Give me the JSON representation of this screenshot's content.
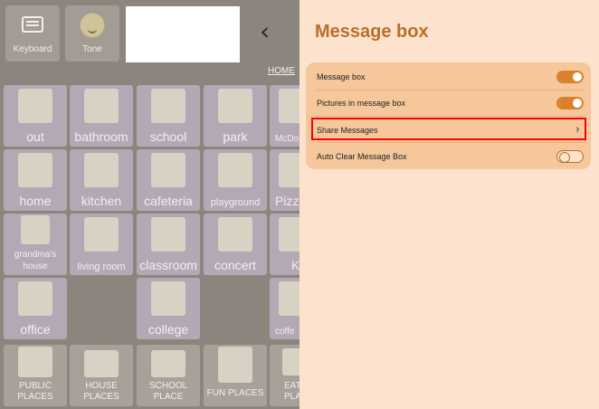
{
  "toolbar": {
    "keyboard_label": "Keyboard",
    "tone_label": "Tone"
  },
  "breadcrumb": {
    "home": "HOME"
  },
  "grid": {
    "cells": [
      {
        "label": "out",
        "icon": "door-out-icon"
      },
      {
        "label": "bathroom",
        "icon": "bathtub-icon"
      },
      {
        "label": "school",
        "icon": "students-icon"
      },
      {
        "label": "park",
        "icon": "park-bench-icon"
      },
      {
        "label": "McDo",
        "icon": "mcdonalds-icon"
      },
      {
        "label": "home",
        "icon": "house-icon"
      },
      {
        "label": "kitchen",
        "icon": "kitchen-icon"
      },
      {
        "label": "cafeteria",
        "icon": "cafeteria-icon"
      },
      {
        "label": "playground",
        "icon": "swing-set-icon"
      },
      {
        "label": "Pizz",
        "icon": "pizza-icon"
      },
      {
        "label": "grandma's house",
        "icon": "grandma-icon"
      },
      {
        "label": "living room",
        "icon": "sofa-icon"
      },
      {
        "label": "classroom",
        "icon": "teacher-icon"
      },
      {
        "label": "concert",
        "icon": "performer-icon"
      },
      {
        "label": "K",
        "icon": "kfc-icon"
      },
      {
        "label": "office",
        "icon": "desk-icon"
      },
      {
        "label": "college",
        "icon": "college-building-icon"
      },
      {
        "label": "coffe",
        "icon": "coffee-icon"
      }
    ],
    "categories": [
      {
        "label": "PUBLIC PLACES",
        "icon": "people-icon"
      },
      {
        "label": "HOUSE PLACES",
        "icon": "house-outline-icon"
      },
      {
        "label": "SCHOOL PLACE",
        "icon": "school-building-icon"
      },
      {
        "label": "FUN PLACES",
        "icon": "rollercoaster-icon"
      },
      {
        "label": "EAT PLA",
        "icon": "eating-icon"
      }
    ]
  },
  "panel": {
    "title": "Message box",
    "settings": [
      {
        "label": "Message box",
        "control": "toggle",
        "on": true
      },
      {
        "label": "Pictures in message box",
        "control": "toggle",
        "on": true
      },
      {
        "label": "Share Messages",
        "control": "chevron"
      },
      {
        "label": "Auto Clear Message Box",
        "control": "toggle",
        "on": false
      }
    ]
  },
  "colors": {
    "accent": "#d9822b",
    "panel_bg": "#fde3cd",
    "card_bg": "#f5c79b",
    "title": "#b86f2a",
    "highlight": "#ff0000"
  }
}
